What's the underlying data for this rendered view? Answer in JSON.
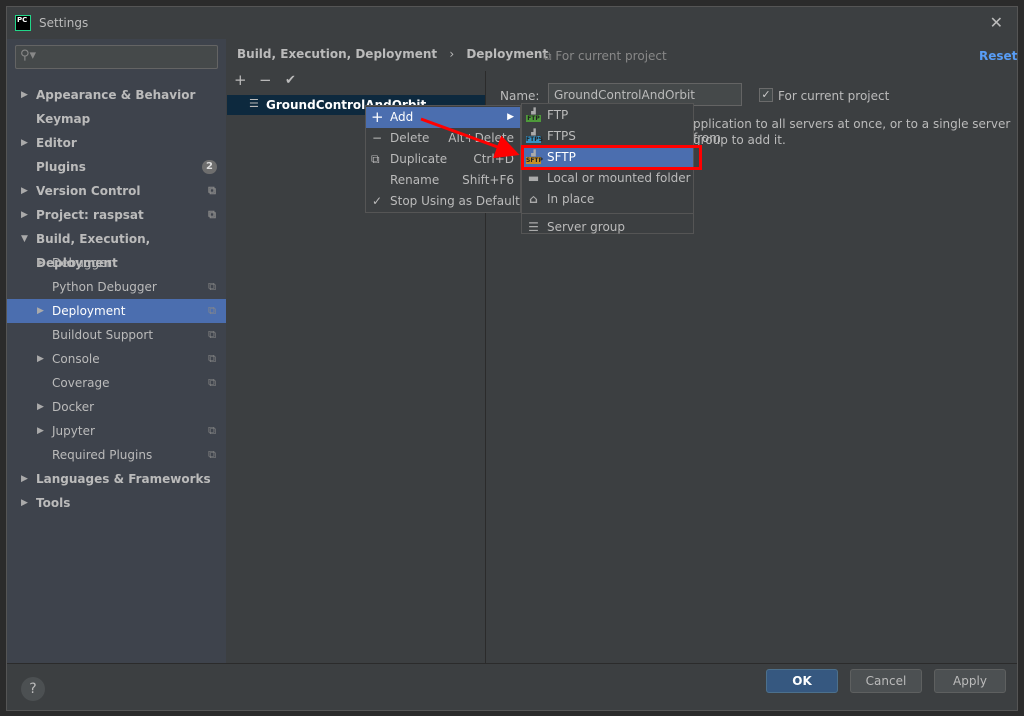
{
  "window": {
    "title": "Settings",
    "logo": "PC"
  },
  "search": {
    "placeholder": ""
  },
  "sidebar": {
    "items": [
      {
        "label": "Appearance & Behavior",
        "bold": true,
        "expandable": true,
        "level": 0
      },
      {
        "label": "Keymap",
        "bold": true,
        "level": 0
      },
      {
        "label": "Editor",
        "bold": true,
        "expandable": true,
        "level": 0
      },
      {
        "label": "Plugins",
        "bold": true,
        "level": 0,
        "badge": "2"
      },
      {
        "label": "Version Control",
        "bold": true,
        "expandable": true,
        "level": 0,
        "project": true
      },
      {
        "label": "Project: raspsat",
        "bold": true,
        "expandable": true,
        "level": 0,
        "project": true
      },
      {
        "label": "Build, Execution, Deployment",
        "bold": true,
        "expanded": true,
        "level": 0
      },
      {
        "label": "Debugger",
        "expandable": true,
        "level": 1
      },
      {
        "label": "Python Debugger",
        "level": 1,
        "project": true
      },
      {
        "label": "Deployment",
        "expandable": true,
        "level": 1,
        "project": true,
        "selected": true
      },
      {
        "label": "Buildout Support",
        "level": 1,
        "project": true
      },
      {
        "label": "Console",
        "expandable": true,
        "level": 1,
        "project": true
      },
      {
        "label": "Coverage",
        "level": 1,
        "project": true
      },
      {
        "label": "Docker",
        "expandable": true,
        "level": 1
      },
      {
        "label": "Jupyter",
        "expandable": true,
        "level": 1,
        "project": true
      },
      {
        "label": "Required Plugins",
        "level": 1,
        "project": true
      },
      {
        "label": "Languages & Frameworks",
        "bold": true,
        "expandable": true,
        "level": 0
      },
      {
        "label": "Tools",
        "bold": true,
        "expandable": true,
        "level": 0
      }
    ]
  },
  "breadcrumb": {
    "parent": "Build, Execution, Deployment",
    "separator": "›",
    "current": "Deployment"
  },
  "scope_note": "For current project",
  "reset_label": "Reset",
  "toolbar": {
    "add": "+",
    "remove": "−",
    "default": "✔"
  },
  "servers": [
    {
      "name": "GroundControlAndOrbit"
    }
  ],
  "form": {
    "name_label": "Name:",
    "name_value": "GroundControlAndOrbit",
    "for_current_project": "For current project",
    "checked": true,
    "hint_line1": "pplication to all servers at once, or to a single server from",
    "hint_line2": "group to add it."
  },
  "context_menu": [
    {
      "label": "Add",
      "icon": "plus-icon",
      "submenu": true,
      "highlighted": true
    },
    {
      "label": "Delete",
      "icon": "minus-icon",
      "shortcut": "Alt+Delete"
    },
    {
      "label": "Duplicate",
      "icon": "duplicate-icon",
      "shortcut": "Ctrl+D"
    },
    {
      "label": "Rename",
      "shortcut": "Shift+F6"
    },
    {
      "label": "Stop Using as Default",
      "icon": "check-icon"
    }
  ],
  "submenu": [
    {
      "label": "FTP",
      "icon_text": "FTP",
      "color": "#4e9a3a"
    },
    {
      "label": "FTPS",
      "icon_text": "FTPS",
      "color": "#3592c4"
    },
    {
      "label": "SFTP",
      "icon_text": "SFTP",
      "color": "#c69026",
      "highlighted": true
    },
    {
      "label": "Local or mounted folder"
    },
    {
      "label": "In place"
    },
    {
      "label": "Server group"
    }
  ],
  "buttons": {
    "help": "?",
    "ok": "OK",
    "cancel": "Cancel",
    "apply": "Apply"
  },
  "colors": {
    "selection": "#4b6eaf",
    "annotation": "#ff0000",
    "link": "#589df6"
  }
}
